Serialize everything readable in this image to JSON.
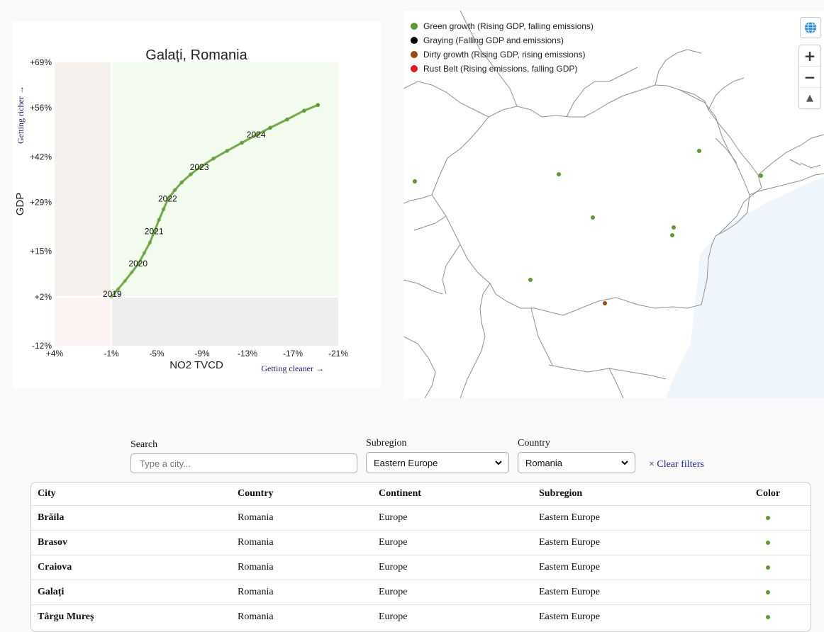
{
  "chart": {
    "title": "Galați, Romania",
    "xlabel": "NO2 TVCD",
    "ylabel": "GDP",
    "x_hint": "Getting cleaner →",
    "y_hint": "Getting richer →",
    "x_ticks": [
      "+4%",
      "-1%",
      "-5%",
      "-9%",
      "-13%",
      "-17%",
      "-21%"
    ],
    "y_ticks": [
      "+69%",
      "+56%",
      "+42%",
      "+29%",
      "+15%",
      "+2%",
      "-12%"
    ],
    "year_labels": [
      "2019",
      "2020",
      "2021",
      "2022",
      "2023",
      "2024"
    ]
  },
  "chart_data": {
    "type": "scatter",
    "title": "Galați, Romania",
    "xlabel": "NO2 TVCD",
    "ylabel": "GDP",
    "xlim": [
      4,
      -21
    ],
    "ylim": [
      -12,
      69
    ],
    "x_ticks": [
      "+4%",
      "-1%",
      "-5%",
      "-9%",
      "-13%",
      "-17%",
      "-21%"
    ],
    "y_ticks": [
      "+69%",
      "+56%",
      "+42%",
      "+29%",
      "+15%",
      "+2%",
      "-12%"
    ],
    "quadrants": {
      "green_growth": "#f3fbee",
      "dirty_growth": "#f6f1ec",
      "rust_belt": "#fdf3f3",
      "graying": "#eeeeee"
    },
    "series": [
      {
        "color": "#5d9c2d",
        "points": [
          {
            "x": -1.0,
            "y": 2.0,
            "label": "2019"
          },
          {
            "x": -1.6,
            "y": 4.2
          },
          {
            "x": -2.2,
            "y": 6.5
          },
          {
            "x": -2.8,
            "y": 9.0
          },
          {
            "x": -3.4,
            "y": 11.5,
            "label": "2020"
          },
          {
            "x": -3.9,
            "y": 14.5
          },
          {
            "x": -4.4,
            "y": 17.5
          },
          {
            "x": -4.8,
            "y": 20.7,
            "label": "2021"
          },
          {
            "x": -5.2,
            "y": 24.0
          },
          {
            "x": -5.6,
            "y": 27.0
          },
          {
            "x": -6.0,
            "y": 30.0,
            "label": "2022"
          },
          {
            "x": -6.6,
            "y": 32.5
          },
          {
            "x": -7.2,
            "y": 34.7
          },
          {
            "x": -8.0,
            "y": 37.0
          },
          {
            "x": -8.8,
            "y": 39.0,
            "label": "2023"
          },
          {
            "x": -10.0,
            "y": 41.5
          },
          {
            "x": -11.2,
            "y": 43.7
          },
          {
            "x": -12.5,
            "y": 46.0
          },
          {
            "x": -13.8,
            "y": 48.3,
            "label": "2024"
          },
          {
            "x": -15.0,
            "y": 50.3
          },
          {
            "x": -16.5,
            "y": 52.7
          },
          {
            "x": -18.0,
            "y": 55.2
          },
          {
            "x": -19.2,
            "y": 56.8
          }
        ]
      }
    ]
  },
  "legend": [
    {
      "label": "Green growth (Rising GDP, falling emissions)",
      "color": "#5d9c2d"
    },
    {
      "label": "Graying (Falling GDP and emissions)",
      "color": "#000000"
    },
    {
      "label": "Dirty growth (Rising GDP, rising emissions)",
      "color": "#9a4a0a"
    },
    {
      "label": "Rust Belt (Rising emissions, falling GDP)",
      "color": "#e8141e"
    }
  ],
  "map": {
    "sea_color": "#eef6fb",
    "globe_icon": "globe-icon",
    "zoom_in": "+",
    "zoom_out": "−",
    "compass": "▲"
  },
  "filters": {
    "search_label": "Search",
    "search_placeholder": "Type a city...",
    "subregion_label": "Subregion",
    "subregion_value": "Eastern Europe",
    "country_label": "Country",
    "country_value": "Romania",
    "clear_label": "× Clear filters"
  },
  "table": {
    "headers": [
      "City",
      "Country",
      "Continent",
      "Subregion",
      "Color"
    ],
    "rows": [
      {
        "city": "Brăila",
        "country": "Romania",
        "continent": "Europe",
        "subregion": "Eastern Europe",
        "color": "#5d9c2d"
      },
      {
        "city": "Brasov",
        "country": "Romania",
        "continent": "Europe",
        "subregion": "Eastern Europe",
        "color": "#5d9c2d"
      },
      {
        "city": "Craiova",
        "country": "Romania",
        "continent": "Europe",
        "subregion": "Eastern Europe",
        "color": "#5d9c2d"
      },
      {
        "city": "Galați",
        "country": "Romania",
        "continent": "Europe",
        "subregion": "Eastern Europe",
        "color": "#5d9c2d"
      },
      {
        "city": "Târgu Mureș",
        "country": "Romania",
        "continent": "Europe",
        "subregion": "Eastern Europe",
        "color": "#5d9c2d"
      }
    ]
  }
}
